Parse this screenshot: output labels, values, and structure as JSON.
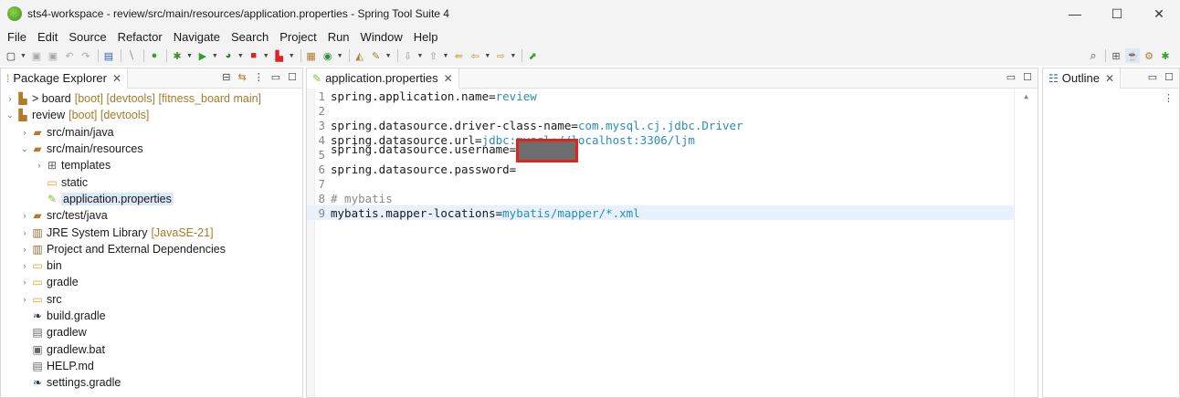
{
  "window": {
    "title": "sts4-workspace - review/src/main/resources/application.properties - Spring Tool Suite 4",
    "minimize": "—",
    "maximize": "☐",
    "close": "✕"
  },
  "menu": [
    "File",
    "Edit",
    "Source",
    "Refactor",
    "Navigate",
    "Search",
    "Project",
    "Run",
    "Window",
    "Help"
  ],
  "explorer": {
    "tab_label": "Package Explorer",
    "items": [
      {
        "label": "> board",
        "decor": "[boot] [devtools] [fitness_board main]"
      },
      {
        "label": "review",
        "decor": "[boot] [devtools]"
      },
      {
        "label": "src/main/java"
      },
      {
        "label": "src/main/resources"
      },
      {
        "label": "templates"
      },
      {
        "label": "static"
      },
      {
        "label": "application.properties"
      },
      {
        "label": "src/test/java"
      },
      {
        "label": "JRE System Library",
        "decor": "[JavaSE-21]"
      },
      {
        "label": "Project and External Dependencies"
      },
      {
        "label": "bin"
      },
      {
        "label": "gradle"
      },
      {
        "label": "src"
      },
      {
        "label": "build.gradle"
      },
      {
        "label": "gradlew"
      },
      {
        "label": "gradlew.bat"
      },
      {
        "label": "HELP.md"
      },
      {
        "label": "settings.gradle"
      }
    ]
  },
  "editor": {
    "tab_label": "application.properties",
    "lines": [
      {
        "n": "1",
        "key": "spring.application.name",
        "val": "review"
      },
      {
        "n": "2"
      },
      {
        "n": "3",
        "key": "spring.datasource.driver-class-name",
        "val": "com.mysql.cj.jdbc.Driver"
      },
      {
        "n": "4",
        "key": "spring.datasource.url",
        "val": "jdbc:mysql://localhost:3306/ljm"
      },
      {
        "n": "5",
        "key": "spring.datasource.username"
      },
      {
        "n": "6",
        "key": "spring.datasource.password"
      },
      {
        "n": "7"
      },
      {
        "n": "8",
        "comment": "# mybatis"
      },
      {
        "n": "9",
        "key": "mybatis.mapper-locations",
        "val": "mybatis/mapper/*.xml"
      }
    ],
    "eq": "="
  },
  "outline": {
    "tab_label": "Outline"
  },
  "icons": {
    "close_tab": "✕",
    "panel_min": "▭",
    "panel_max": "☐"
  }
}
